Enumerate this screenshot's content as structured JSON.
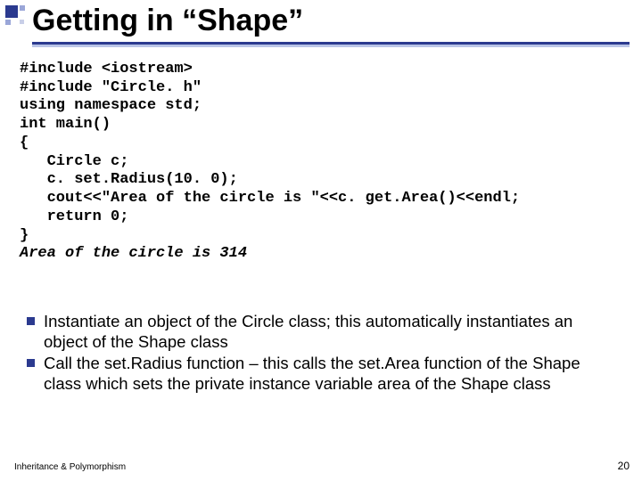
{
  "title": "Getting in “Shape”",
  "code": {
    "lines": [
      "#include <iostream>",
      "#include \"Circle. h\"",
      "using namespace std;",
      "int main()",
      "{",
      "   Circle c;",
      "   c. set.Radius(10. 0);",
      "   cout<<\"Area of the circle is \"<<c. get.Area()<<endl;",
      "   return 0;",
      "}"
    ],
    "output_line": "Area of the circle is 314"
  },
  "bullets": [
    "Instantiate an object of the Circle class; this automatically instantiates an object of the Shape class",
    "Call the set.Radius function – this calls the set.Area function of the Shape class which sets the private instance variable area of the Shape class"
  ],
  "footer": {
    "left": "Inheritance & Polymorphism",
    "page": "20"
  },
  "colors": {
    "accent": "#2b3a8f"
  }
}
